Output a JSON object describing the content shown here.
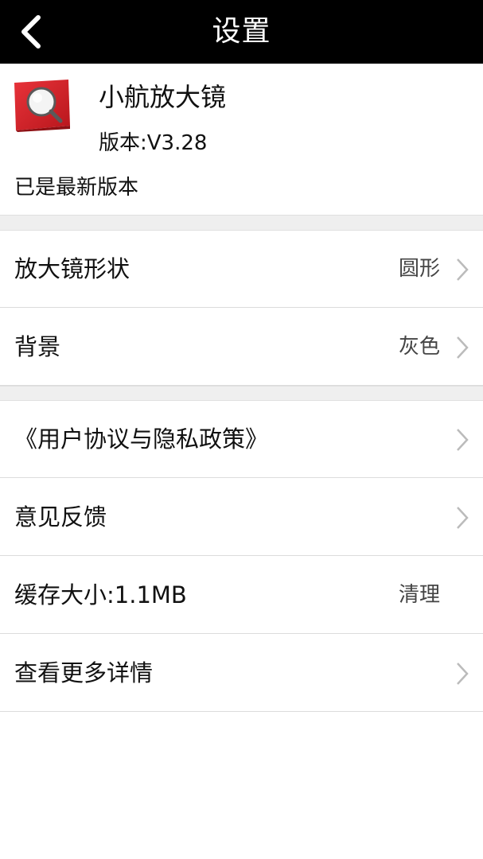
{
  "header": {
    "title": "设置",
    "back_icon": "chevron-left-icon"
  },
  "app": {
    "name": "小航放大镜",
    "version": "版本:V3.28",
    "update_status": "已是最新版本",
    "icon": "magnifier-app-icon",
    "icon_color": "#d9252b"
  },
  "settings": {
    "shape_label": "放大镜形状",
    "shape_value": "圆形",
    "background_label": "背景",
    "background_value": "灰色"
  },
  "links": {
    "agreement_label": "《用户协议与隐私政策》",
    "feedback_label": "意见反馈",
    "cache_label": "缓存大小:1.1MB",
    "cache_action": "清理",
    "more_label": "查看更多详情"
  },
  "colors": {
    "header_bg": "#000000",
    "separator_bg": "#efefef",
    "chevron": "#bbbbbb"
  }
}
